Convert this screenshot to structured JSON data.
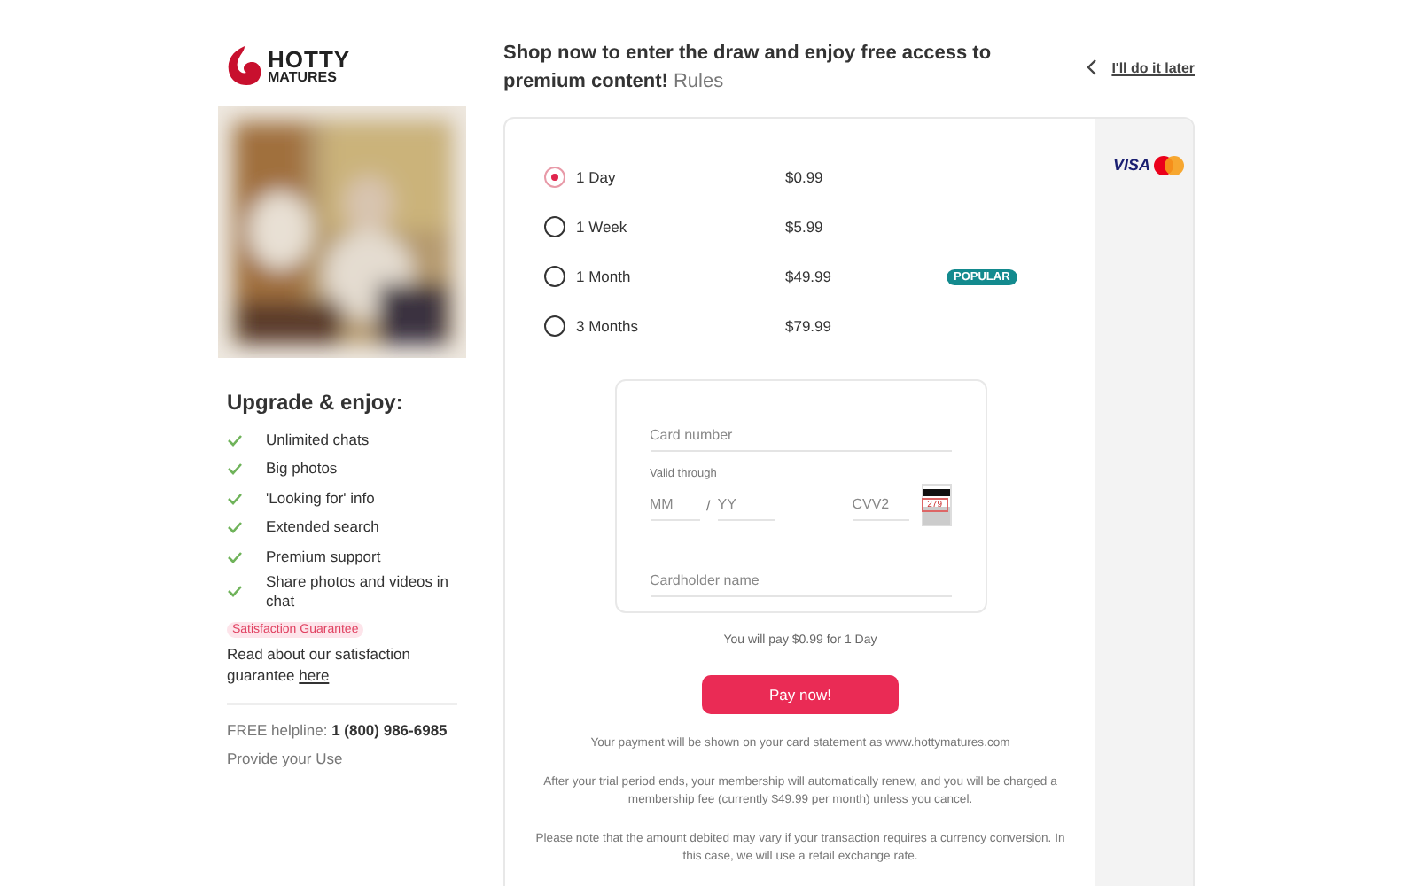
{
  "logo": {
    "line_1": "HOTTY",
    "line_2": "MATURES"
  },
  "photo": {
    "kind": "picture"
  },
  "benefits": {
    "title": "Upgrade & enjoy:",
    "items": [
      "Unlimited chats",
      "Big photos",
      "'Looking for' info",
      "Extended search",
      "Premium support",
      "Share photos and videos in chat"
    ]
  },
  "guarantee": {
    "badge": "Satisfaction Guarantee",
    "text": "Read about our satisfaction guarantee",
    "link": "here"
  },
  "helpline": {
    "label": "FREE helpline:",
    "number": "1 (800) 986-6985"
  },
  "provide_text": "Provide your Use",
  "headline": {
    "text": "Shop now to enter the draw and enjoy free access to premium content!",
    "link": "Rules"
  },
  "skip_link": "I'll do it later",
  "plans": [
    {
      "label": "1 Day",
      "price": "$0.99",
      "selected": true
    },
    {
      "label": "1 Week",
      "price": "$5.99",
      "selected": false
    },
    {
      "label": "1 Month",
      "price": "$49.99",
      "selected": false,
      "badge": "POPULAR"
    },
    {
      "label": "3 Months",
      "price": "$79.99",
      "selected": false
    }
  ],
  "card_brands": [
    "VISA"
  ],
  "form": {
    "card_number": {
      "placeholder": "Card number"
    },
    "valid_through": "Valid through",
    "month": {
      "placeholder": "MM"
    },
    "separator": "/",
    "year": {
      "placeholder": "YY"
    },
    "cvv": {
      "placeholder": "CVV2"
    },
    "cvv_hint": "279",
    "cardholder": {
      "placeholder": "Cardholder name"
    }
  },
  "summary": "You will pay $0.99 for 1 Day",
  "pay_button": "Pay now!",
  "notes": [
    "Your payment will be shown on your card statement as www.hottymatures.com",
    "After your trial period ends, your membership will automatically renew, and you will be charged a membership fee (currently $49.99 per month) unless you cancel.",
    "Please note that the amount debited may vary if your transaction requires a currency conversion. In this case, we will use a retail exchange rate."
  ]
}
